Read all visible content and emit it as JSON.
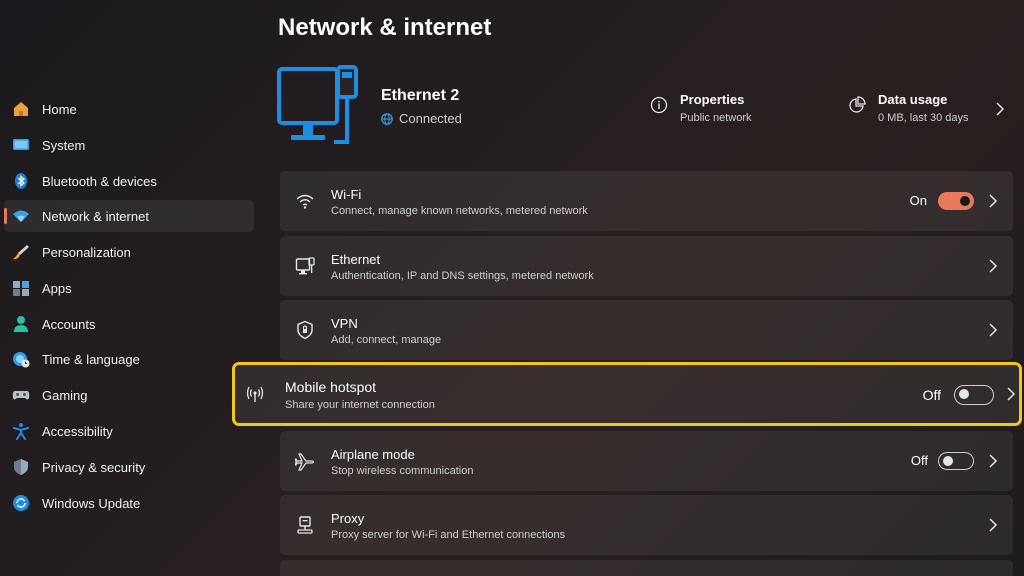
{
  "header": {
    "title": "Network & internet"
  },
  "colors": {
    "accent": "#e8795c",
    "highlight": "#f5c518",
    "blue": "#1e8fe0"
  },
  "sidebar": {
    "items": [
      {
        "label": "Home",
        "icon": "home-icon"
      },
      {
        "label": "System",
        "icon": "system-icon"
      },
      {
        "label": "Bluetooth & devices",
        "icon": "bluetooth-icon"
      },
      {
        "label": "Network & internet",
        "icon": "wifi-icon",
        "active": true
      },
      {
        "label": "Personalization",
        "icon": "brush-icon"
      },
      {
        "label": "Apps",
        "icon": "apps-icon"
      },
      {
        "label": "Accounts",
        "icon": "person-icon"
      },
      {
        "label": "Time & language",
        "icon": "globe-clock-icon"
      },
      {
        "label": "Gaming",
        "icon": "gamepad-icon"
      },
      {
        "label": "Accessibility",
        "icon": "accessibility-icon"
      },
      {
        "label": "Privacy & security",
        "icon": "shield-icon"
      },
      {
        "label": "Windows Update",
        "icon": "update-icon"
      }
    ]
  },
  "hero": {
    "name": "Ethernet 2",
    "status": "Connected",
    "properties": {
      "title": "Properties",
      "sub": "Public network"
    },
    "data_usage": {
      "title": "Data usage",
      "sub": "0 MB, last 30 days"
    }
  },
  "cards": [
    {
      "title": "Wi-Fi",
      "sub": "Connect, manage known networks, metered network",
      "state": "On",
      "icon": "wifi-icon"
    },
    {
      "title": "Ethernet",
      "sub": "Authentication, IP and DNS settings, metered network",
      "icon": "ethernet-icon"
    },
    {
      "title": "VPN",
      "sub": "Add, connect, manage",
      "icon": "vpn-shield-icon"
    },
    {
      "title": "Mobile hotspot",
      "sub": "Share your internet connection",
      "state": "Off",
      "icon": "hotspot-icon"
    },
    {
      "title": "Airplane mode",
      "sub": "Stop wireless communication",
      "state": "Off",
      "icon": "airplane-icon"
    },
    {
      "title": "Proxy",
      "sub": "Proxy server for Wi-Fi and Ethernet connections",
      "icon": "proxy-icon"
    }
  ]
}
